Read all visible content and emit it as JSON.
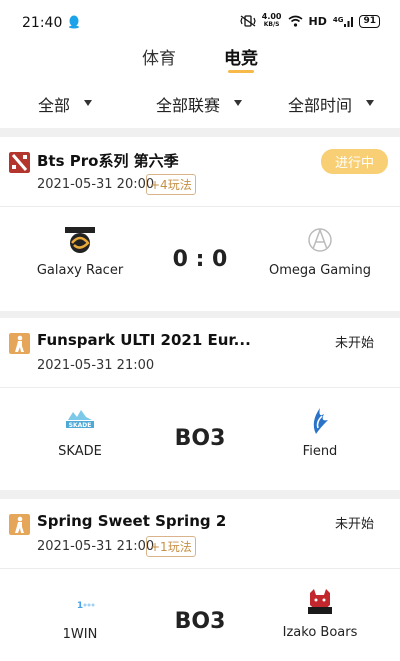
{
  "status_bar": {
    "time": "21:40",
    "net_speed_value": "4.00",
    "net_speed_unit": "KB/S",
    "hd": "HD",
    "signal": "4G",
    "battery": "91"
  },
  "category_tabs": [
    {
      "label": "体育",
      "active": false
    },
    {
      "label": "电竞",
      "active": true
    }
  ],
  "filters": [
    {
      "label": "全部"
    },
    {
      "label": "全部联赛"
    },
    {
      "label": "全部时间"
    }
  ],
  "matches": [
    {
      "game_icon": "dota2-icon",
      "league": "Bts Pro系列 第六季",
      "time": "2021-05-31 20:00",
      "plays_badge": "+4玩法",
      "status": "进行中",
      "home_team": "Galaxy Racer",
      "home_logo": "galaxy-racer-logo",
      "score": "0 : 0",
      "away_team": "Omega Gaming",
      "away_logo": "omega-gaming-logo"
    },
    {
      "game_icon": "csgo-icon",
      "league": "Funspark ULTI 2021 Eur...",
      "time": "2021-05-31 21:00",
      "status": "未开始",
      "home_team": "SKADE",
      "home_logo": "skade-logo",
      "score": "BO3",
      "away_team": "Fiend",
      "away_logo": "fiend-logo"
    },
    {
      "game_icon": "csgo-icon",
      "league": "Spring Sweet Spring 2",
      "time": "2021-05-31 21:00",
      "plays_badge": "+1玩法",
      "status": "未开始",
      "home_team": "1WIN",
      "home_logo": "1win-logo",
      "score": "BO3",
      "away_team": "Izako Boars",
      "away_logo": "izako-boars-logo"
    }
  ],
  "colors": {
    "accent": "#f6b94a",
    "live_pill": "#f8cf74",
    "badge_text": "#c78f44",
    "dota_red": "#b3352d",
    "csgo_orange": "#e5a65a"
  }
}
